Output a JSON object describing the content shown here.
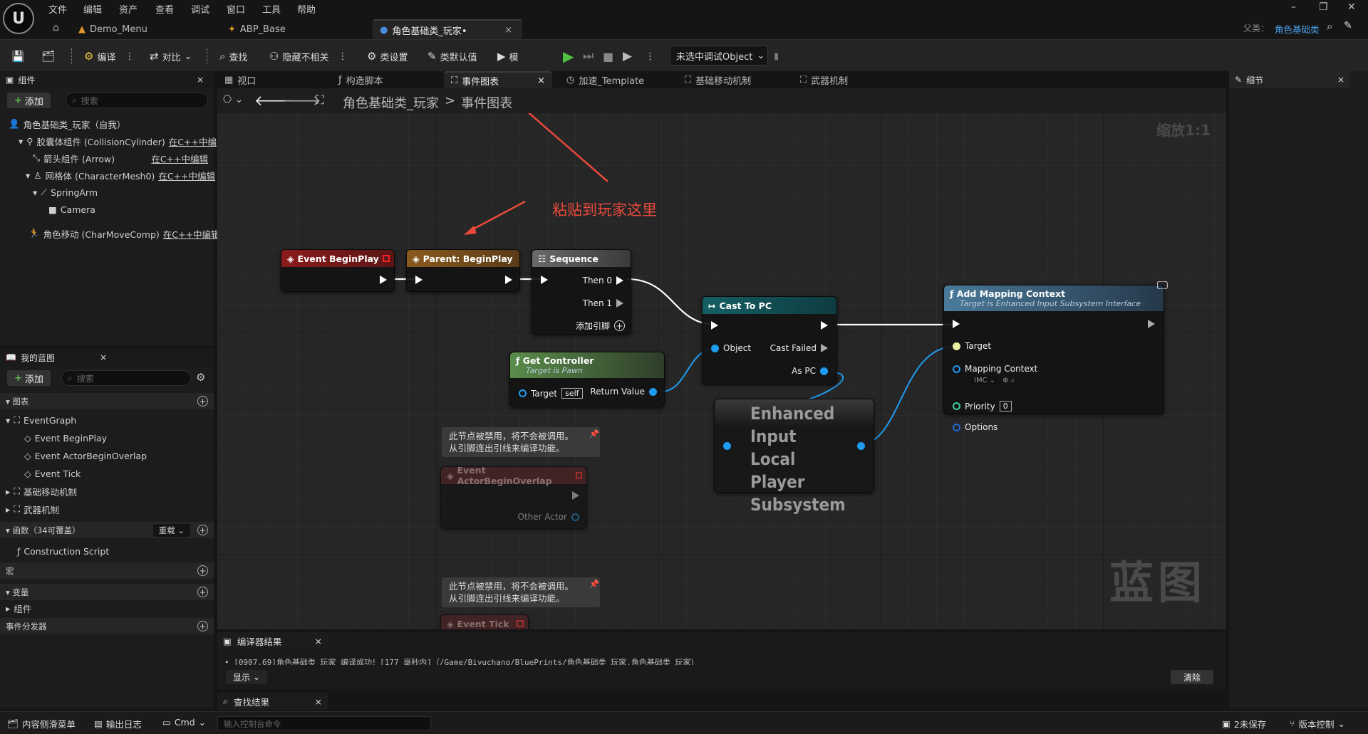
{
  "menu": [
    "文件",
    "编辑",
    "资产",
    "查看",
    "调试",
    "窗口",
    "工具",
    "帮助"
  ],
  "tabs": [
    {
      "label": "Demo_Menu"
    },
    {
      "label": "ABP_Base"
    },
    {
      "label": "角色基础类_玩家•"
    }
  ],
  "parent_label": "父类：",
  "parent_value": "角色基础类",
  "toolbar": {
    "compile": "编译",
    "diff": "对比",
    "find": "查找",
    "hide_unrelated": "隐藏不相关",
    "class_settings": "类设置",
    "class_defaults": "类默认值",
    "simulate": "模",
    "debug_object": "未选中调试Object"
  },
  "components": {
    "title": "组件",
    "add": "添加",
    "search_placeholder": "搜索",
    "items": [
      {
        "label": "角色基础类_玩家（自我）",
        "edit": ""
      },
      {
        "label": "胶囊体组件 (CollisionCylinder)",
        "edit": "在C++中编"
      },
      {
        "label": "箭头组件 (Arrow)",
        "edit": "在C++中编辑"
      },
      {
        "label": "网格体 (CharacterMesh0)",
        "edit": "在C++中编辑"
      },
      {
        "label": "SpringArm",
        "edit": ""
      },
      {
        "label": "Camera",
        "edit": ""
      },
      {
        "label": "角色移动 (CharMoveComp)",
        "edit": "在C++中编辑"
      }
    ]
  },
  "my_blueprint": {
    "title": "我的蓝图",
    "add": "添加",
    "search_placeholder": "搜索",
    "graphs": "图表",
    "event_graph": "EventGraph",
    "events": [
      "Event BeginPlay",
      "Event ActorBeginOverlap",
      "Event Tick"
    ],
    "graph_items": [
      "基础移动机制",
      "武器机制"
    ],
    "functions": "函数（34可覆盖）",
    "override": "重载",
    "construction": "Construction Script",
    "macros": "宏",
    "variables": "变量",
    "components": "组件",
    "dispatchers": "事件分发器"
  },
  "graph_tabs": [
    "视口",
    "构造脚本",
    "事件图表",
    "加速_Template",
    "基础移动机制",
    "武器机制"
  ],
  "breadcrumb": {
    "root": "角色基础类_玩家",
    "sep": ">",
    "current": "事件图表"
  },
  "zoom": "缩放1:1",
  "watermark": "蓝图",
  "annotation": "粘贴到玩家这里",
  "nodes": {
    "begin_play": "Event BeginPlay",
    "parent_begin": "Parent: BeginPlay",
    "sequence": {
      "title": "Sequence",
      "then0": "Then 0",
      "then1": "Then 1",
      "add_pin": "添加引脚"
    },
    "get_controller": {
      "title": "Get Controller",
      "subtitle": "Target is Pawn",
      "target": "Target",
      "self": "self",
      "ret": "Return Value"
    },
    "cast": {
      "title": "Cast To PC",
      "object": "Object",
      "failed": "Cast Failed",
      "as": "As PC"
    },
    "subsystem": "Enhanced Input Local Player Subsystem",
    "add_mapping": {
      "title": "Add Mapping Context",
      "subtitle": "Target is Enhanced Input Subsystem Interface",
      "target": "Target",
      "mapping": "Mapping Context",
      "imc": "IMC",
      "priority": "Priority",
      "priority_val": "0",
      "options": "Options"
    },
    "disabled_comment": "此节点被禁用，将不会被调用。\n从引脚连出引线来编译功能。",
    "overlap": {
      "title": "Event ActorBeginOverlap",
      "other": "Other Actor"
    },
    "tick": "Event Tick"
  },
  "details": {
    "title": "细节"
  },
  "compiler": {
    "title": "编译器结果",
    "log": "[0907.69]角色基础类_玩家 编译成功！[177 毫秒内]（/Game/Biyuchang/BluePrints/角色基础类_玩家.角色基础类_玩家）",
    "show": "显示",
    "clear": "清除"
  },
  "find_results": "查找结果",
  "status": {
    "content_drawer": "内容侧滑菜单",
    "output_log": "输出日志",
    "cmd": "Cmd",
    "console_placeholder": "输入控制台命令",
    "unsaved": "2未保存",
    "source_control": "版本控制"
  }
}
